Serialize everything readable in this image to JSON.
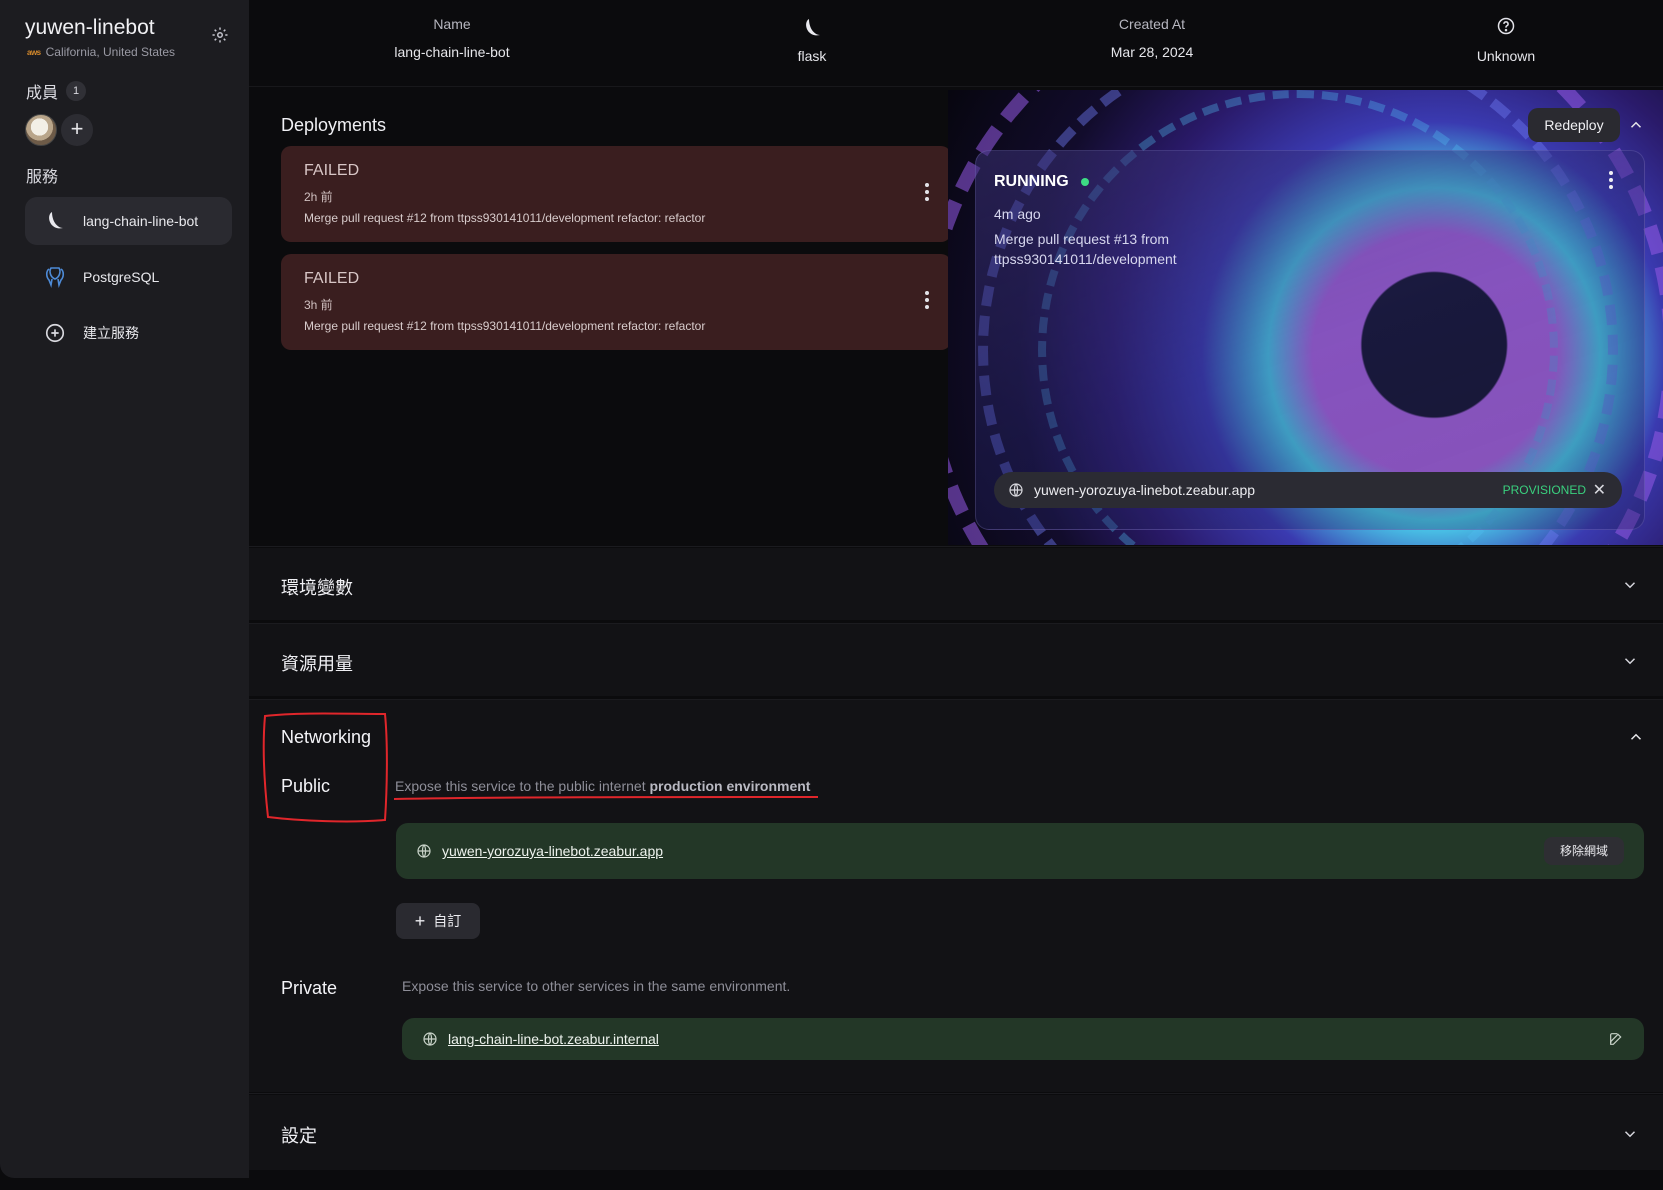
{
  "project": {
    "name": "yuwen-linebot",
    "provider_badge": "aws",
    "region": "California, United States"
  },
  "sidebar": {
    "members_label": "成員",
    "members_count": "1",
    "services_label": "服務",
    "services": [
      {
        "label": "lang-chain-line-bot",
        "icon": "flask-icon",
        "active": true
      },
      {
        "label": "PostgreSQL",
        "icon": "postgresql-icon",
        "active": false
      },
      {
        "label": "建立服務",
        "icon": "add-circle-icon",
        "active": false
      }
    ]
  },
  "header": {
    "name_label": "Name",
    "name_value": "lang-chain-line-bot",
    "framework_value": "flask",
    "created_label": "Created At",
    "created_value": "Mar 28, 2024",
    "status_value": "Unknown"
  },
  "deployments": {
    "title": "Deployments",
    "redeploy_label": "Redeploy",
    "failed": [
      {
        "status": "FAILED",
        "when": "2h 前",
        "message": "Merge pull request #12 from ttpss930141011/development refactor: refactor"
      },
      {
        "status": "FAILED",
        "when": "3h 前",
        "message": "Merge pull request #12 from ttpss930141011/development refactor: refactor"
      }
    ],
    "running": {
      "status": "RUNNING",
      "when": "4m ago",
      "message": "Merge pull request #13 from ttpss930141011/development",
      "domain": "yuwen-yorozuya-linebot.zeabur.app",
      "domain_status": "PROVISIONED"
    }
  },
  "sections": {
    "env": "環境變數",
    "resources": "資源用量",
    "settings": "設定"
  },
  "networking": {
    "title": "Networking",
    "public_label": "Public",
    "public_desc_prefix": "Expose this service to the public internet ",
    "public_desc_bold": "production environment",
    "public_domain": "yuwen-yorozuya-linebot.zeabur.app",
    "remove_domain_label": "移除網域",
    "custom_label": "自訂",
    "private_label": "Private",
    "private_desc": "Expose this service to other services in the same environment.",
    "private_domain": "lang-chain-line-bot.zeabur.internal"
  },
  "colors": {
    "failed_bg": "#3a1e1f",
    "domain_row_bg": "#233727",
    "provisioned": "#3ad07e",
    "running_dot": "#3ddc84",
    "annotation": "#e0262b"
  }
}
